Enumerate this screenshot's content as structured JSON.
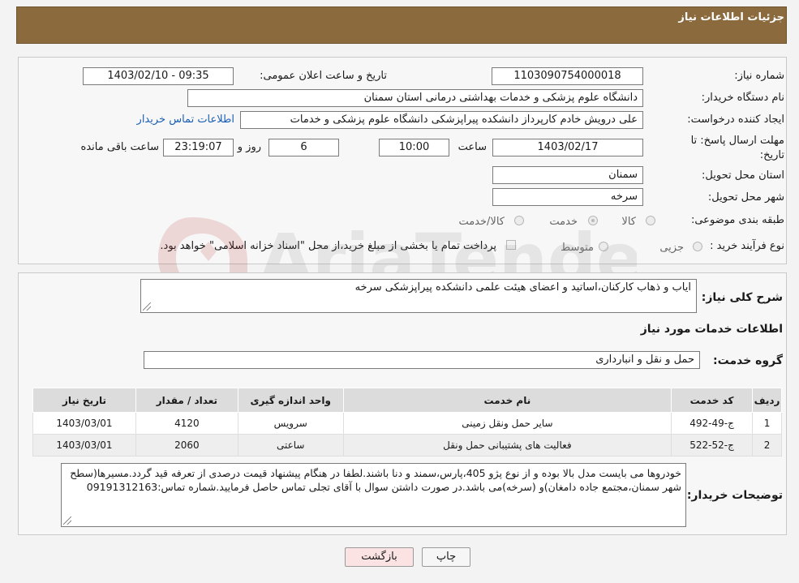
{
  "header": {
    "title": "جزئیات اطلاعات نیاز"
  },
  "info": {
    "need_number_label": "شماره نیاز:",
    "need_number": "1103090754000018",
    "announce_label": "تاریخ و ساعت اعلان عمومی:",
    "announce_value": "1403/02/10 - 09:35",
    "buyer_label": "نام دستگاه خریدار:",
    "buyer_value": "دانشگاه علوم پزشکی و خدمات بهداشتی  درمانی استان سمنان",
    "creator_label": "ایجاد کننده درخواست:",
    "creator_value": "علی درویش خادم کارپرداز دانشکده پیراپزشکی دانشگاه علوم پزشکی و خدمات",
    "contact_link": "اطلاعات تماس خریدار",
    "deadline_label_1": "مهلت ارسال پاسخ: تا",
    "deadline_label_2": "تاریخ:",
    "deadline_date": "1403/02/17",
    "time_label": "ساعت",
    "deadline_time": "10:00",
    "days_value": "6",
    "days_label": "روز و",
    "remaining_value": "23:19:07",
    "remaining_label": "ساعت باقی مانده",
    "province_label": "استان محل تحویل:",
    "province_value": "سمنان",
    "city_label": "شهر محل تحویل:",
    "city_value": "سرخه",
    "category_label": "طبقه بندی موضوعی:",
    "category_options": [
      "کالا",
      "خدمت",
      "کالا/خدمت"
    ],
    "category_selected": "خدمت",
    "process_label": "نوع فرآیند خرید :",
    "process_options": [
      "جزیی",
      "متوسط"
    ],
    "payment_note": "پرداخت تمام یا بخشی از مبلغ خرید،از محل \"اسناد خزانه اسلامی\" خواهد بود."
  },
  "summary": {
    "label": "شرح کلی نیاز:",
    "value": "ایاب و ذهاب کارکنان،اساتید و اعضای هیئت علمی دانشکده پیراپزشکی سرخه"
  },
  "services": {
    "section_title": "اطلاعات خدمات مورد نیاز",
    "group_label": "گروه خدمت:",
    "group_value": "حمل و نقل و انبارداری",
    "columns": [
      "ردیف",
      "کد خدمت",
      "نام خدمت",
      "واحد اندازه گیری",
      "تعداد / مقدار",
      "تاریخ نیاز"
    ],
    "rows": [
      {
        "row": "1",
        "code": "ج-49-492",
        "name": "سایر حمل ونقل زمینی",
        "unit": "سرویس",
        "qty": "4120",
        "date": "1403/03/01"
      },
      {
        "row": "2",
        "code": "ج-52-522",
        "name": "فعالیت های پشتیبانی حمل ونقل",
        "unit": "ساعتی",
        "qty": "2060",
        "date": "1403/03/01"
      }
    ]
  },
  "buyer_notes": {
    "label": "توضیحات خریدار:",
    "value": "خودروها می بایست مدل بالا بوده و از نوع پژو 405،پارس،سمند و دنا باشند.لطفا در هنگام پیشنهاد قیمت درصدی از تعرفه قید گردد.مسیرها(سطح شهر سمنان،مجتمع جاده دامغان)و (سرخه)می باشد.در صورت داشتن سوال با آقای تجلی تماس حاصل فرمایید.شماره تماس:09191312163"
  },
  "buttons": {
    "print": "چاپ",
    "back": "بازگشت"
  },
  "watermark": {
    "text": "AriaTender.neT"
  },
  "colors": {
    "header": "#8b6a3e",
    "back_button": "#fbe3e3",
    "link": "#1a5fb4"
  }
}
